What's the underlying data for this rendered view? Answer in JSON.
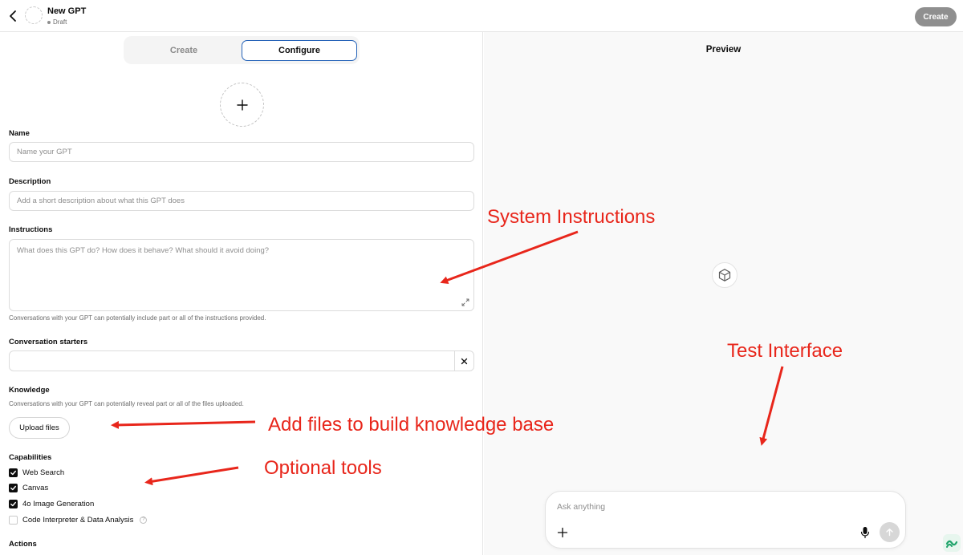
{
  "topbar": {
    "title": "New GPT",
    "status": "Draft",
    "create_button": "Create"
  },
  "tabs": [
    {
      "label": "Create"
    },
    {
      "label": "Configure"
    }
  ],
  "form": {
    "name": {
      "label": "Name",
      "placeholder": "Name your GPT"
    },
    "description": {
      "label": "Description",
      "placeholder": "Add a short description about what this GPT does"
    },
    "instructions": {
      "label": "Instructions",
      "placeholder": "What does this GPT do? How does it behave? What should it avoid doing?",
      "hint": "Conversations with your GPT can potentially include part or all of the instructions provided."
    },
    "starters": {
      "label": "Conversation starters",
      "value": ""
    },
    "knowledge": {
      "label": "Knowledge",
      "hint": "Conversations with your GPT can potentially reveal part or all of the files uploaded.",
      "upload_button": "Upload files"
    },
    "capabilities": {
      "label": "Capabilities",
      "items": [
        {
          "label": "Web Search",
          "checked": true
        },
        {
          "label": "Canvas",
          "checked": true
        },
        {
          "label": "4o Image Generation",
          "checked": true
        },
        {
          "label": "Code Interpreter & Data Analysis",
          "checked": false,
          "help": "?"
        }
      ]
    },
    "actions": {
      "label": "Actions"
    }
  },
  "preview": {
    "title": "Preview",
    "composer_placeholder": "Ask anything"
  },
  "annotations": {
    "system_instructions": "System Instructions",
    "test_interface": "Test Interface",
    "knowledge_base": "Add files to build knowledge base",
    "optional_tools": "Optional tools",
    "color": "#e8261b"
  },
  "icons": [
    "chevron-left-icon",
    "plus-icon",
    "resize-icon",
    "close-icon",
    "check-icon",
    "cube-icon",
    "mic-icon",
    "arrow-up-icon",
    "logo-icon"
  ]
}
